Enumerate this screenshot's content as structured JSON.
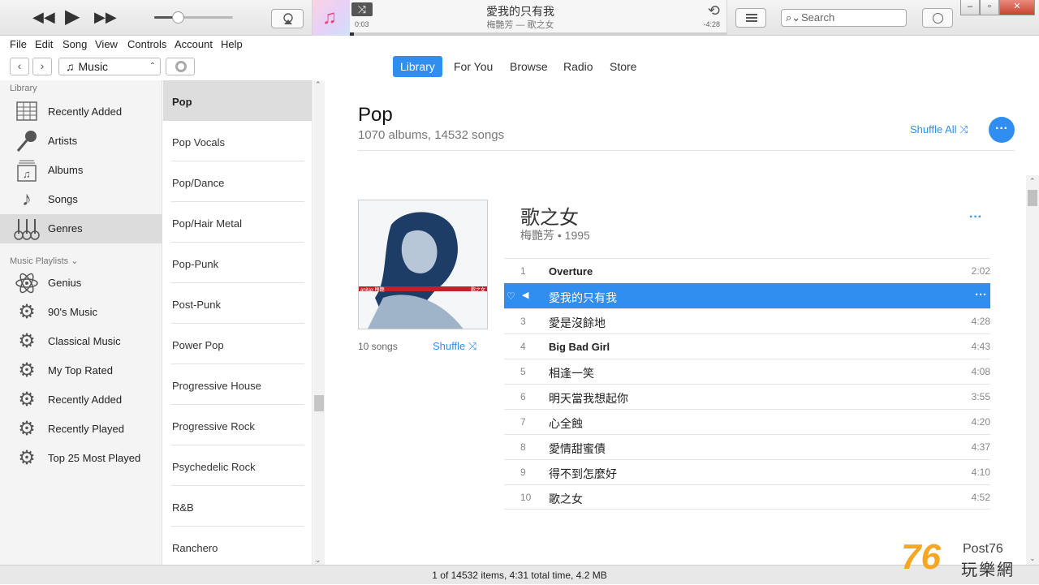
{
  "player": {
    "volume_fraction": 0.3,
    "now_playing_title": "愛我的只有我",
    "now_playing_subtitle": "梅艷芳 — 歌之女",
    "elapsed": "0:03",
    "remaining": "-4:28",
    "progress_fraction": 0.01,
    "search_placeholder": "Search"
  },
  "menu": [
    "File",
    "Edit",
    "Song",
    "View",
    "Controls",
    "Account",
    "Help"
  ],
  "nav": {
    "media_selector": "Music",
    "tabs": [
      "Library",
      "For You",
      "Browse",
      "Radio",
      "Store"
    ],
    "active_tab": "Library"
  },
  "sidebar": {
    "library_heading": "Library",
    "library_items": [
      {
        "label": "Recently Added",
        "icon": "grid-calendar-icon"
      },
      {
        "label": "Artists",
        "icon": "microphone-icon"
      },
      {
        "label": "Albums",
        "icon": "album-icon"
      },
      {
        "label": "Songs",
        "icon": "music-note-icon"
      },
      {
        "label": "Genres",
        "icon": "guitars-icon"
      }
    ],
    "playlists_heading": "Music Playlists",
    "playlist_items": [
      {
        "label": "Genius",
        "icon": "atom-icon"
      },
      {
        "label": "90's Music",
        "icon": "gear-icon"
      },
      {
        "label": "Classical Music",
        "icon": "gear-icon"
      },
      {
        "label": "My Top Rated",
        "icon": "gear-icon"
      },
      {
        "label": "Recently Added",
        "icon": "gear-icon"
      },
      {
        "label": "Recently Played",
        "icon": "gear-icon"
      },
      {
        "label": "Top 25 Most Played",
        "icon": "gear-icon"
      }
    ]
  },
  "genres": {
    "items": [
      "Pop",
      "Pop Vocals",
      "Pop/Dance",
      "Pop/Hair Metal",
      "Pop-Punk",
      "Post-Punk",
      "Power Pop",
      "Progressive House",
      "Progressive Rock",
      "Psychedelic Rock",
      "R&B",
      "Ranchero"
    ],
    "selected": "Pop"
  },
  "main": {
    "genre_title": "Pop",
    "genre_stats": "1070 albums, 14532 songs",
    "shuffle_all_label": "Shuffle All",
    "album": {
      "title": "歌之女",
      "artist_year": "梅艷芳 • 1995",
      "song_count": "10 songs",
      "shuffle_label": "Shuffle",
      "cover_text_left": "anitax 梅艷",
      "cover_text_right": "歌之女"
    },
    "tracks": [
      {
        "num": "1",
        "title": "Overture",
        "duration": "2:02",
        "bold": true
      },
      {
        "num": "2",
        "title": "愛我的只有我",
        "duration": "",
        "playing": true
      },
      {
        "num": "3",
        "title": "愛是沒餘地",
        "duration": "4:28"
      },
      {
        "num": "4",
        "title": "Big Bad Girl",
        "duration": "4:43",
        "bold": true
      },
      {
        "num": "5",
        "title": "相逢一笑",
        "duration": "4:08"
      },
      {
        "num": "6",
        "title": "明天當我想起你",
        "duration": "3:55"
      },
      {
        "num": "7",
        "title": "心全蝕",
        "duration": "4:20"
      },
      {
        "num": "8",
        "title": "愛情甜蜜債",
        "duration": "4:37"
      },
      {
        "num": "9",
        "title": "得不到怎麼好",
        "duration": "4:10"
      },
      {
        "num": "10",
        "title": "歌之女",
        "duration": "4:52"
      }
    ]
  },
  "status": "1 of 14532 items, 4:31 total time, 4.2 MB",
  "watermark": {
    "number": "76",
    "post": "Post76",
    "chinese": "玩樂網"
  },
  "colors": {
    "accent": "#2f8ef0",
    "watermark": "#f5a623"
  }
}
